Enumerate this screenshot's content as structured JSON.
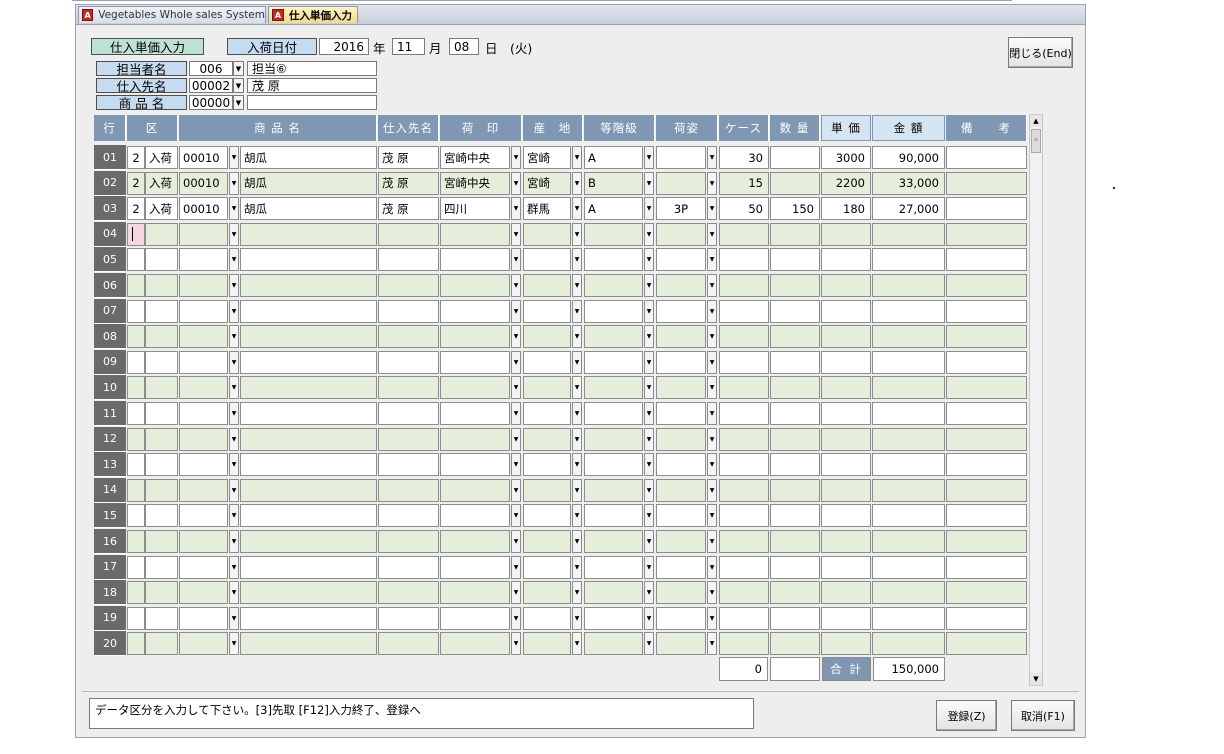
{
  "tabs": [
    {
      "label": "Vegetables Whole sales System",
      "icon": "access-app-icon"
    },
    {
      "label": "仕入単価入力",
      "icon": "access-form-icon"
    }
  ],
  "header": {
    "form_title": "仕入単価入力",
    "arrival_date_label": "入荷日付",
    "year": "2016",
    "year_unit": "年",
    "month": "11",
    "month_unit": "月",
    "day": "08",
    "day_unit": "日",
    "weekday": "(火)",
    "close_button": "閉じる(End)",
    "staff_label": "担当者名",
    "staff_code": "006",
    "staff_name": "担当⑥",
    "supplier_label": "仕入先名",
    "supplier_code": "00002",
    "supplier_name": "茂 原",
    "product_label": "商 品 名",
    "product_code": "00000",
    "product_name": ""
  },
  "grid": {
    "columns": [
      "行",
      "区",
      "商 品 名",
      "仕入先名",
      "荷　印",
      "産　地",
      "等階級",
      "荷姿",
      "ケース",
      "数 量",
      "単 価",
      "金 額",
      "備　　考"
    ],
    "rows": [
      {
        "no": "01",
        "kubun": "2",
        "type": "入荷",
        "code": "00010",
        "product": "胡瓜",
        "supplier": "茂 原",
        "mark": "宮崎中央",
        "origin": "宮崎",
        "grade": "A",
        "pack": "",
        "cases": "30",
        "qty": "",
        "unit_price": "3000",
        "amount": "90,000",
        "note": ""
      },
      {
        "no": "02",
        "kubun": "2",
        "type": "入荷",
        "code": "00010",
        "product": "胡瓜",
        "supplier": "茂 原",
        "mark": "宮崎中央",
        "origin": "宮崎",
        "grade": "B",
        "pack": "",
        "cases": "15",
        "qty": "",
        "unit_price": "2200",
        "amount": "33,000",
        "note": ""
      },
      {
        "no": "03",
        "kubun": "2",
        "type": "入荷",
        "code": "00010",
        "product": "胡瓜",
        "supplier": "茂 原",
        "mark": "四川",
        "origin": "群馬",
        "grade": "A",
        "pack": "3P",
        "cases": "50",
        "qty": "150",
        "unit_price": "180",
        "amount": "27,000",
        "note": ""
      },
      {
        "no": "04",
        "kubun": "",
        "type": "",
        "code": "",
        "product": "",
        "supplier": "",
        "mark": "",
        "origin": "",
        "grade": "",
        "pack": "",
        "cases": "",
        "qty": "",
        "unit_price": "",
        "amount": "",
        "note": ""
      },
      {
        "no": "05",
        "kubun": "",
        "type": "",
        "code": "",
        "product": "",
        "supplier": "",
        "mark": "",
        "origin": "",
        "grade": "",
        "pack": "",
        "cases": "",
        "qty": "",
        "unit_price": "",
        "amount": "",
        "note": ""
      },
      {
        "no": "06",
        "kubun": "",
        "type": "",
        "code": "",
        "product": "",
        "supplier": "",
        "mark": "",
        "origin": "",
        "grade": "",
        "pack": "",
        "cases": "",
        "qty": "",
        "unit_price": "",
        "amount": "",
        "note": ""
      },
      {
        "no": "07",
        "kubun": "",
        "type": "",
        "code": "",
        "product": "",
        "supplier": "",
        "mark": "",
        "origin": "",
        "grade": "",
        "pack": "",
        "cases": "",
        "qty": "",
        "unit_price": "",
        "amount": "",
        "note": ""
      },
      {
        "no": "08",
        "kubun": "",
        "type": "",
        "code": "",
        "product": "",
        "supplier": "",
        "mark": "",
        "origin": "",
        "grade": "",
        "pack": "",
        "cases": "",
        "qty": "",
        "unit_price": "",
        "amount": "",
        "note": ""
      },
      {
        "no": "09",
        "kubun": "",
        "type": "",
        "code": "",
        "product": "",
        "supplier": "",
        "mark": "",
        "origin": "",
        "grade": "",
        "pack": "",
        "cases": "",
        "qty": "",
        "unit_price": "",
        "amount": "",
        "note": ""
      },
      {
        "no": "10",
        "kubun": "",
        "type": "",
        "code": "",
        "product": "",
        "supplier": "",
        "mark": "",
        "origin": "",
        "grade": "",
        "pack": "",
        "cases": "",
        "qty": "",
        "unit_price": "",
        "amount": "",
        "note": ""
      },
      {
        "no": "11",
        "kubun": "",
        "type": "",
        "code": "",
        "product": "",
        "supplier": "",
        "mark": "",
        "origin": "",
        "grade": "",
        "pack": "",
        "cases": "",
        "qty": "",
        "unit_price": "",
        "amount": "",
        "note": ""
      },
      {
        "no": "12",
        "kubun": "",
        "type": "",
        "code": "",
        "product": "",
        "supplier": "",
        "mark": "",
        "origin": "",
        "grade": "",
        "pack": "",
        "cases": "",
        "qty": "",
        "unit_price": "",
        "amount": "",
        "note": ""
      },
      {
        "no": "13",
        "kubun": "",
        "type": "",
        "code": "",
        "product": "",
        "supplier": "",
        "mark": "",
        "origin": "",
        "grade": "",
        "pack": "",
        "cases": "",
        "qty": "",
        "unit_price": "",
        "amount": "",
        "note": ""
      },
      {
        "no": "14",
        "kubun": "",
        "type": "",
        "code": "",
        "product": "",
        "supplier": "",
        "mark": "",
        "origin": "",
        "grade": "",
        "pack": "",
        "cases": "",
        "qty": "",
        "unit_price": "",
        "amount": "",
        "note": ""
      },
      {
        "no": "15",
        "kubun": "",
        "type": "",
        "code": "",
        "product": "",
        "supplier": "",
        "mark": "",
        "origin": "",
        "grade": "",
        "pack": "",
        "cases": "",
        "qty": "",
        "unit_price": "",
        "amount": "",
        "note": ""
      },
      {
        "no": "16",
        "kubun": "",
        "type": "",
        "code": "",
        "product": "",
        "supplier": "",
        "mark": "",
        "origin": "",
        "grade": "",
        "pack": "",
        "cases": "",
        "qty": "",
        "unit_price": "",
        "amount": "",
        "note": ""
      },
      {
        "no": "17",
        "kubun": "",
        "type": "",
        "code": "",
        "product": "",
        "supplier": "",
        "mark": "",
        "origin": "",
        "grade": "",
        "pack": "",
        "cases": "",
        "qty": "",
        "unit_price": "",
        "amount": "",
        "note": ""
      },
      {
        "no": "18",
        "kubun": "",
        "type": "",
        "code": "",
        "product": "",
        "supplier": "",
        "mark": "",
        "origin": "",
        "grade": "",
        "pack": "",
        "cases": "",
        "qty": "",
        "unit_price": "",
        "amount": "",
        "note": ""
      },
      {
        "no": "19",
        "kubun": "",
        "type": "",
        "code": "",
        "product": "",
        "supplier": "",
        "mark": "",
        "origin": "",
        "grade": "",
        "pack": "",
        "cases": "",
        "qty": "",
        "unit_price": "",
        "amount": "",
        "note": ""
      },
      {
        "no": "20",
        "kubun": "",
        "type": "",
        "code": "",
        "product": "",
        "supplier": "",
        "mark": "",
        "origin": "",
        "grade": "",
        "pack": "",
        "cases": "",
        "qty": "",
        "unit_price": "",
        "amount": "",
        "note": ""
      }
    ],
    "totals": {
      "cases": "0",
      "qty": "",
      "label": "合 計",
      "amount": "150,000"
    }
  },
  "footer": {
    "message": "データ区分を入力して下さい。[3]先取 [F12]入力終了、登録へ",
    "register_button": "登録(Z)",
    "cancel_button": "取消(F1)"
  },
  "colors": {
    "header_blue": "#7f97b2",
    "row_green": "#e5eedb",
    "row_white": "#ffffff",
    "row_number_bg": "#6a6a6a",
    "label_blue": "#c5dbef",
    "label_green": "#bfe0d5",
    "active_cell": "#f6d7de"
  }
}
